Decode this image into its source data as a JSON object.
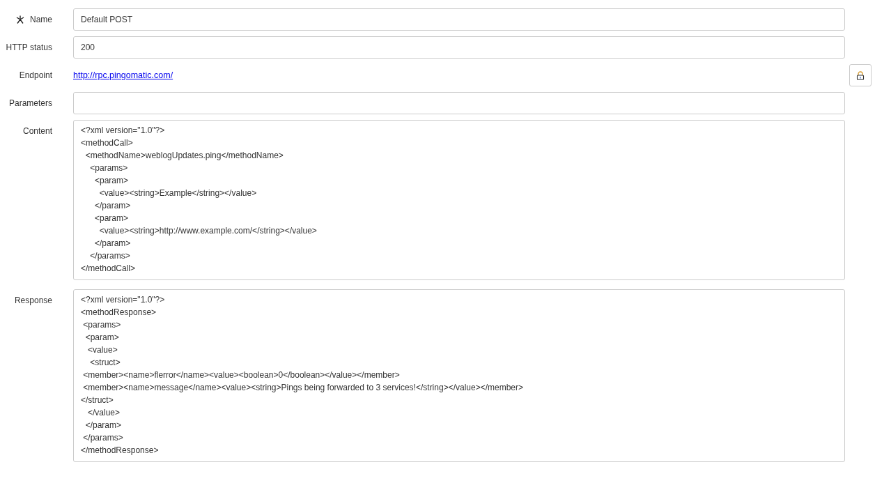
{
  "fields": [
    {
      "kind": "text",
      "label": "Name",
      "required": true,
      "value": "Default POST"
    },
    {
      "kind": "text",
      "label": "HTTP status",
      "required": false,
      "value": "200"
    },
    {
      "kind": "link",
      "label": "Endpoint",
      "required": false,
      "value": "http://rpc.pingomatic.com/"
    },
    {
      "kind": "text",
      "label": "Parameters",
      "required": false
    },
    {
      "kind": "textarea",
      "label": "Content",
      "required": false,
      "value": "<?xml version=\"1.0\"?>\n<methodCall>\n  <methodName>weblogUpdates.ping</methodName>\n    <params>\n      <param>\n        <value><string>Example</string></value>\n      </param>\n      <param>\n        <value><string>http://www.example.com/</string></value>\n      </param>\n    </params>\n</methodCall>"
    },
    {
      "kind": "textarea",
      "label": "Response",
      "required": false,
      "value": "<?xml version=\"1.0\"?>\n<methodResponse>\n <params>\n  <param>\n   <value>\n    <struct>\n <member><name>flerror</name><value><boolean>0</boolean></value></member>\n <member><name>message</name><value><string>Pings being forwarded to 3 services!</string></value></member>\n</struct>\n   </value>\n  </param>\n </params>\n</methodResponse>"
    }
  ]
}
